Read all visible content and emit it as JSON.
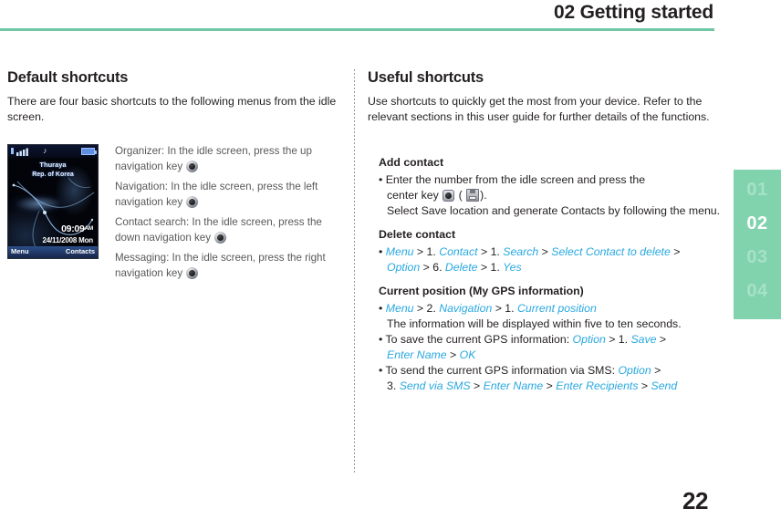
{
  "header": {
    "title": "02 Getting started",
    "rule_color": "#6ec8a4"
  },
  "chapter_tab": {
    "background": "#81d3ae",
    "active_index": 1,
    "items": [
      "01",
      "02",
      "03",
      "04"
    ]
  },
  "page_number": "22",
  "left_column": {
    "title": "Default shortcuts",
    "intro": "There are four basic shortcuts to the following menus from the idle screen.",
    "phone": {
      "operator": "Thuraya",
      "region": "Rep. of Korea",
      "time": "09:09",
      "ampm": "AM",
      "date": "24/11/2008  Mon",
      "softkey_left": "Menu",
      "softkey_right": "Contacts",
      "music_note": "♪"
    },
    "shortcuts": [
      {
        "text_before": "Organizer: In the idle screen, press the up navigation key ",
        "icon": "navigation-key-icon",
        "text_after": ""
      },
      {
        "text_before": "Navigation: In the idle screen, press the left navigation key ",
        "icon": "navigation-key-icon",
        "text_after": ""
      },
      {
        "text_before": "Contact search: In the idle screen, press the down navigation key ",
        "icon": "navigation-key-icon",
        "text_after": ""
      },
      {
        "text_before": "Messaging: In the idle screen, press the right navigation key ",
        "icon": "navigation-key-icon",
        "text_after": ""
      }
    ]
  },
  "right_column": {
    "title": "Useful shortcuts",
    "intro": "Use shortcuts to quickly get the most from your device. Refer to the relevant sections in this user guide for further details of the functions.",
    "add_contact": {
      "heading": "Add contact",
      "line1": "• Enter the number from the idle screen and press the",
      "line2_before": "center key ",
      "line2_mid": " ( ",
      "line2_after": ").",
      "line3": "Select Save location and generate Contacts by following the menu."
    },
    "delete_contact": {
      "heading": "Delete contact",
      "line1_bullet": "• ",
      "line1_parts": [
        {
          "t": "Menu",
          "m": true
        },
        {
          "t": " > 1. ",
          "m": false
        },
        {
          "t": "Contact",
          "m": true
        },
        {
          "t": " > 1. ",
          "m": false
        },
        {
          "t": "Search",
          "m": true
        },
        {
          "t": " > ",
          "m": false
        },
        {
          "t": "Select Contact to delete",
          "m": true
        },
        {
          "t": " >",
          "m": false
        }
      ],
      "line2_parts": [
        {
          "t": "Option",
          "m": true
        },
        {
          "t": " > 6. ",
          "m": false
        },
        {
          "t": "Delete",
          "m": true
        },
        {
          "t": " > 1. ",
          "m": false
        },
        {
          "t": "Yes",
          "m": true
        }
      ]
    },
    "current_position": {
      "heading": "Current position (My GPS information)",
      "line1_bullet": "• ",
      "line1_parts": [
        {
          "t": "Menu",
          "m": true
        },
        {
          "t": " > 2. ",
          "m": false
        },
        {
          "t": "Navigation",
          "m": true
        },
        {
          "t": " > 1. ",
          "m": false
        },
        {
          "t": "Current position",
          "m": true
        }
      ],
      "line2": "The information will be displayed within five to ten seconds.",
      "line3_bullet": "• ",
      "line3_parts": [
        {
          "t": "To save the current GPS information: ",
          "m": false
        },
        {
          "t": "Option",
          "m": true
        },
        {
          "t": " > 1. ",
          "m": false
        },
        {
          "t": "Save",
          "m": true
        },
        {
          "t": " >",
          "m": false
        }
      ],
      "line4_parts": [
        {
          "t": "Enter Name",
          "m": true
        },
        {
          "t": " > ",
          "m": false
        },
        {
          "t": "OK",
          "m": true
        }
      ],
      "line5_bullet": "• ",
      "line5_parts": [
        {
          "t": "To send the current GPS information via SMS: ",
          "m": false
        },
        {
          "t": "Option",
          "m": true
        },
        {
          "t": " >",
          "m": false
        }
      ],
      "line6_parts": [
        {
          "t": "3. ",
          "m": false
        },
        {
          "t": "Send via SMS",
          "m": true
        },
        {
          "t": " > ",
          "m": false
        },
        {
          "t": "Enter Name",
          "m": true
        },
        {
          "t": " > ",
          "m": false
        },
        {
          "t": "Enter Recipients",
          "m": true
        },
        {
          "t": " > ",
          "m": false
        },
        {
          "t": "Send",
          "m": true
        }
      ]
    }
  }
}
